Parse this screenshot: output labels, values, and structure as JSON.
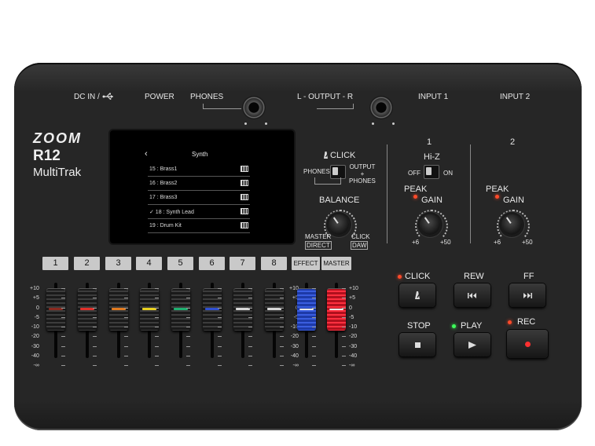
{
  "brand": {
    "logo": "ZOOM",
    "model": "R12",
    "subtitle": "MultiTrak"
  },
  "top_labels": {
    "dc_in": "DC IN /",
    "usb_icon": "usb-icon",
    "power": "POWER",
    "phones": "PHONES",
    "output": "L - OUTPUT - R",
    "input1": "INPUT 1",
    "input2": "INPUT 2"
  },
  "screen": {
    "title": "Synth",
    "back_icon": "chevron-left-icon",
    "rows": [
      {
        "label": "15 : Brass1"
      },
      {
        "label": "16 : Brass2"
      },
      {
        "label": "17 : Brass3"
      },
      {
        "label": "✓ 18 : Synth Lead"
      },
      {
        "label": "19 : Drum Kit"
      }
    ]
  },
  "click_section": {
    "label": "CLICK",
    "phones": "PHONES",
    "output_phones": "OUTPUT\n+\nPHONES",
    "balance": "BALANCE",
    "master": "MASTER",
    "direct": "DIRECT",
    "click": "CLICK",
    "daw": "DAW"
  },
  "input1": {
    "number": "1",
    "hiz": "Hi-Z",
    "off": "OFF",
    "on": "ON",
    "peak": "PEAK",
    "gain": "GAIN",
    "min": "+6",
    "max": "+50"
  },
  "input2": {
    "number": "2",
    "peak": "PEAK",
    "gain": "GAIN",
    "min": "+6",
    "max": "+50"
  },
  "channels": [
    "1",
    "2",
    "3",
    "4",
    "5",
    "6",
    "7",
    "8",
    "EFFECT",
    "MASTER"
  ],
  "fader_scale": [
    "+10",
    "+5",
    "0",
    "-5",
    "-10",
    "-20",
    "-30",
    "-40",
    "-∞"
  ],
  "stripe_colors": [
    "#8a2a20",
    "#e0302a",
    "#e07a20",
    "#e8d020",
    "#20b070",
    "#3050d0",
    "#d8d8d8",
    "#d8d8d8"
  ],
  "transport": {
    "click": "CLICK",
    "rew": "REW",
    "ff": "FF",
    "stop": "STOP",
    "play": "PLAY",
    "rec": "REC"
  },
  "colors": {
    "led_red": "#ff4a2a",
    "led_green": "#3dff5a",
    "effect_fader": "#2a4ad0",
    "master_fader": "#ff2a3a"
  }
}
